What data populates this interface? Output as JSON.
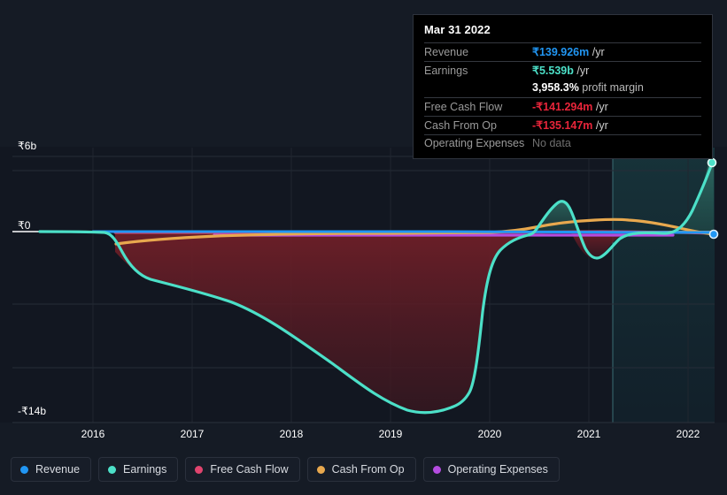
{
  "page": {
    "background": "#151b25",
    "plot_background": "#121721"
  },
  "tooltip": {
    "title": "Mar 31 2022",
    "rows": [
      {
        "label": "Revenue",
        "value": "₹139.926m",
        "suffix": " /yr",
        "color": "#2196f3",
        "note": null
      },
      {
        "label": "Earnings",
        "value": "₹5.539b",
        "suffix": " /yr",
        "color": "#4ce0c8",
        "note": null
      },
      {
        "label": "",
        "value": "3,958.3%",
        "suffix": " profit margin",
        "color": "#ffffff",
        "note": "margin"
      },
      {
        "label": "Free Cash Flow",
        "value": "-₹141.294m",
        "suffix": " /yr",
        "color": "#e8253a",
        "note": null
      },
      {
        "label": "Cash From Op",
        "value": "-₹135.147m",
        "suffix": " /yr",
        "color": "#e8253a",
        "note": null
      },
      {
        "label": "Operating Expenses",
        "value": "No data",
        "suffix": "",
        "color": "#6f6f6f",
        "note": null
      }
    ]
  },
  "legend": {
    "items": [
      {
        "label": "Revenue",
        "color": "#2196f3"
      },
      {
        "label": "Earnings",
        "color": "#4ce0c8"
      },
      {
        "label": "Free Cash Flow",
        "color": "#e0446e"
      },
      {
        "label": "Cash From Op",
        "color": "#e8a84e"
      },
      {
        "label": "Operating Expenses",
        "color": "#b44ce0"
      }
    ]
  },
  "chart_data": {
    "type": "line",
    "title": "",
    "xlabel": "",
    "ylabel": "",
    "currency": "₹",
    "x_tick_labels": [
      "2016",
      "2017",
      "2018",
      "2019",
      "2020",
      "2021",
      "2022"
    ],
    "y_tick_labels": [
      "₹6b",
      "₹0",
      "-₹14b"
    ],
    "ylim": [
      -14,
      6
    ],
    "y_unit": "billions INR",
    "grid": true,
    "legend_position": "bottom",
    "zero_line": 0,
    "forecast_boundary_year": 2021.15,
    "x": [
      2015.55,
      2015.9,
      2016.0,
      2016.15,
      2016.3,
      2016.5,
      2016.75,
      2017.0,
      2017.3,
      2017.6,
      2018.0,
      2018.3,
      2018.6,
      2019.0,
      2019.25,
      2019.5,
      2019.7,
      2019.85,
      2019.95,
      2020.1,
      2020.35,
      2020.6,
      2020.8,
      2021.0,
      2021.2,
      2021.5,
      2021.8,
      2022.0,
      2022.15
    ],
    "series": [
      {
        "name": "Revenue",
        "color": "#2196f3",
        "values": [
          null,
          0.05,
          0.05,
          0.05,
          0.05,
          0.05,
          0.05,
          0.05,
          0.05,
          0.05,
          0.05,
          0.05,
          0.05,
          0.05,
          0.05,
          0.06,
          0.06,
          0.06,
          0.06,
          0.07,
          0.08,
          0.1,
          0.11,
          0.12,
          0.13,
          0.14,
          0.14,
          0.14,
          0.14
        ]
      },
      {
        "name": "Earnings",
        "color": "#4ce0c8",
        "values": [
          0.0,
          0.0,
          0.0,
          -0.4,
          -1.5,
          -2.1,
          -2.3,
          -2.5,
          -3.0,
          -3.8,
          -5.3,
          -6.9,
          -8.6,
          -10.9,
          -11.6,
          -11.5,
          -11.2,
          -11.0,
          -10.9,
          -4.2,
          -0.2,
          1.3,
          -0.6,
          -1.1,
          -0.3,
          -0.15,
          -0.1,
          0.2,
          5.54
        ]
      },
      {
        "name": "Free Cash Flow",
        "color": "#e0446e",
        "values": [
          null,
          null,
          -0.1,
          -0.35,
          -0.4,
          -0.38,
          -0.35,
          -0.3,
          -0.28,
          -0.25,
          -0.22,
          -0.2,
          -0.18,
          -0.16,
          -0.15,
          -0.15,
          -0.14,
          -0.14,
          -0.14,
          -0.14,
          -0.13,
          -0.12,
          -0.12,
          -0.12,
          -0.13,
          -0.14,
          -0.14,
          -0.14,
          -0.14
        ]
      },
      {
        "name": "Cash From Op",
        "color": "#e8a84e",
        "values": [
          null,
          null,
          -0.1,
          -0.9,
          -0.85,
          -0.78,
          -0.68,
          -0.55,
          -0.45,
          -0.35,
          -0.25,
          -0.2,
          -0.16,
          -0.14,
          -0.13,
          -0.12,
          -0.11,
          -0.1,
          -0.1,
          -0.05,
          0.1,
          0.32,
          0.45,
          0.52,
          0.52,
          0.45,
          0.25,
          -0.05,
          -0.135
        ]
      },
      {
        "name": "Operating Expenses",
        "color": "#b44ce0",
        "values": [
          null,
          null,
          null,
          null,
          null,
          -0.12,
          -0.12,
          -0.12,
          -0.12,
          -0.12,
          -0.12,
          -0.12,
          -0.12,
          -0.12,
          -0.12,
          -0.12,
          -0.12,
          -0.12,
          -0.12,
          -0.12,
          -0.12,
          -0.12,
          -0.12,
          -0.12,
          -0.12,
          -0.12,
          -0.12,
          -0.12,
          -0.12
        ]
      }
    ],
    "markers": [
      {
        "series": "Earnings",
        "x": 2022.15,
        "y": 5.54,
        "color": "#4ce0c8"
      },
      {
        "series": "Revenue",
        "x": 2022.15,
        "y": 0.14,
        "color": "#2196f3"
      }
    ]
  }
}
